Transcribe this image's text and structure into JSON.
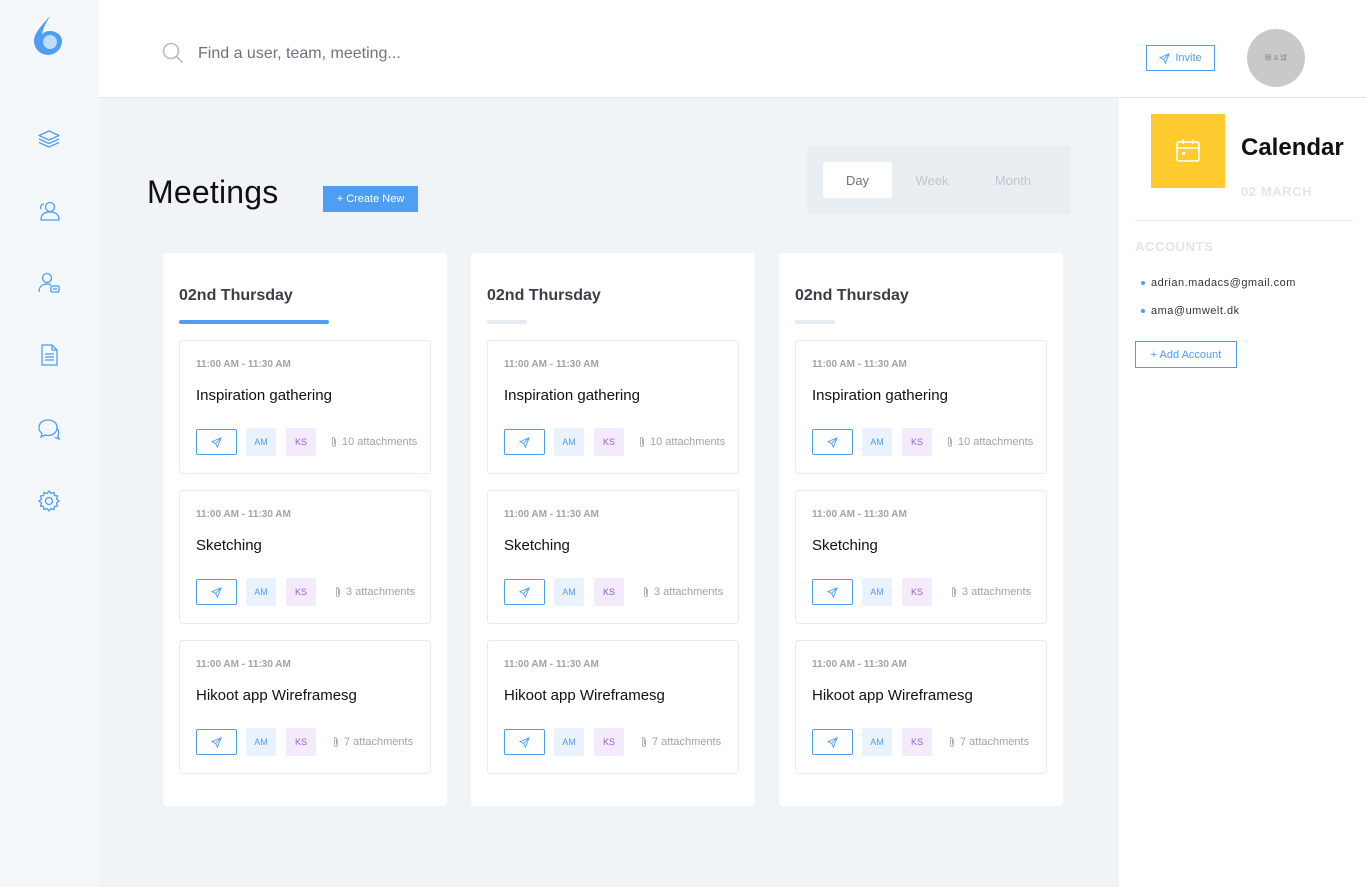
{
  "search": {
    "placeholder": "Find a user, team, meeting..."
  },
  "header": {
    "invite_label": "Invite",
    "avatar_text": "眼 & 球"
  },
  "sidebar": {
    "items": [
      {
        "name": "layers"
      },
      {
        "name": "users"
      },
      {
        "name": "user-card"
      },
      {
        "name": "document"
      },
      {
        "name": "chat"
      },
      {
        "name": "settings"
      }
    ]
  },
  "main": {
    "title": "Meetings",
    "create_label": "+ Create New",
    "views": [
      "Day",
      "Week",
      "Month"
    ],
    "active_view": "Day",
    "days": [
      {
        "heading": "02nd Thursday",
        "active": true,
        "meetings": [
          {
            "time": "11:00 AM - 11:30 AM",
            "title": "Inspiration gathering",
            "tag1": "AM",
            "tag2": "KS",
            "attachments": "10 attachments"
          },
          {
            "time": "11:00 AM - 11:30 AM",
            "title": "Sketching",
            "tag1": "AM",
            "tag2": "KS",
            "attachments": "3 attachments"
          },
          {
            "time": "11:00 AM - 11:30 AM",
            "title": "Hikoot app Wireframesg",
            "tag1": "AM",
            "tag2": "KS",
            "attachments": "7 attachments"
          }
        ]
      },
      {
        "heading": "02nd Thursday",
        "active": false,
        "meetings": [
          {
            "time": "11:00 AM - 11:30 AM",
            "title": "Inspiration gathering",
            "tag1": "AM",
            "tag2": "KS",
            "attachments": "10 attachments"
          },
          {
            "time": "11:00 AM - 11:30 AM",
            "title": "Sketching",
            "tag1": "AM",
            "tag2": "KS",
            "attachments": "3 attachments"
          },
          {
            "time": "11:00 AM - 11:30 AM",
            "title": "Hikoot app Wireframesg",
            "tag1": "AM",
            "tag2": "KS",
            "attachments": "7 attachments"
          }
        ]
      },
      {
        "heading": "02nd Thursday",
        "active": false,
        "meetings": [
          {
            "time": "11:00 AM - 11:30 AM",
            "title": "Inspiration gathering",
            "tag1": "AM",
            "tag2": "KS",
            "attachments": "10 attachments"
          },
          {
            "time": "11:00 AM - 11:30 AM",
            "title": "Sketching",
            "tag1": "AM",
            "tag2": "KS",
            "attachments": "3 attachments"
          },
          {
            "time": "11:00 AM - 11:30 AM",
            "title": "Hikoot app Wireframesg",
            "tag1": "AM",
            "tag2": "KS",
            "attachments": "7 attachments"
          }
        ]
      }
    ]
  },
  "calendar": {
    "title": "Calendar",
    "date": "02 MARCH",
    "accounts_heading": "ACCOUNTS",
    "accounts": [
      "adrian.madacs@gmail.com",
      "ama@umwelt.dk"
    ],
    "add_account_label": "+ Add Account"
  },
  "colors": {
    "accent": "#4e9ef4",
    "calendar_tile": "#ffcb2f",
    "tag_ks": "#9c5ad6"
  }
}
